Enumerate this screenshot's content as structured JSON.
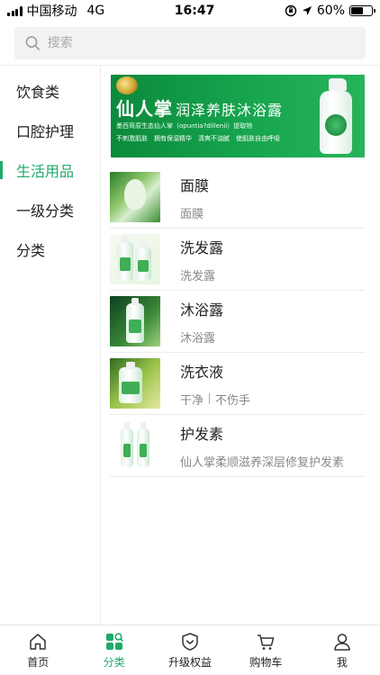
{
  "status_bar": {
    "carrier": "中国移动",
    "network": "4G",
    "time": "16:47",
    "battery_percent": "60%",
    "battery_level": 0.6
  },
  "search": {
    "placeholder": "搜索"
  },
  "sidebar": {
    "items": [
      {
        "label": "饮食类"
      },
      {
        "label": "口腔护理"
      },
      {
        "label": "生活用品"
      },
      {
        "label": "一级分类"
      },
      {
        "label": "分类"
      }
    ],
    "active_index": 2
  },
  "banner": {
    "title": "仙人掌",
    "title_sub": "润泽养肤沐浴露",
    "subtitle": "墨西哥原生态仙人掌（opuntia?dillenii）提取物",
    "tags": "不刺激肌肤　拥有保湿精华　清爽不油腻　使肌肤自由呼吸"
  },
  "products": [
    {
      "name": "面膜",
      "desc": [
        "面膜"
      ]
    },
    {
      "name": "洗发露",
      "desc": [
        "洗发露"
      ]
    },
    {
      "name": "沐浴露",
      "desc": [
        "沐浴露"
      ]
    },
    {
      "name": "洗衣液",
      "desc": [
        "干净",
        "不伤手"
      ]
    },
    {
      "name": "护发素",
      "desc": [
        "仙人掌柔顺滋养深层修复护发素"
      ]
    }
  ],
  "tabbar": {
    "items": [
      {
        "label": "首页",
        "icon": "home-icon"
      },
      {
        "label": "分类",
        "icon": "category-icon"
      },
      {
        "label": "升级权益",
        "icon": "upgrade-icon"
      },
      {
        "label": "购物车",
        "icon": "cart-icon"
      },
      {
        "label": "我",
        "icon": "user-icon"
      }
    ],
    "active_index": 1
  },
  "colors": {
    "accent": "#1faa6a",
    "banner_green": "#17a54e"
  }
}
